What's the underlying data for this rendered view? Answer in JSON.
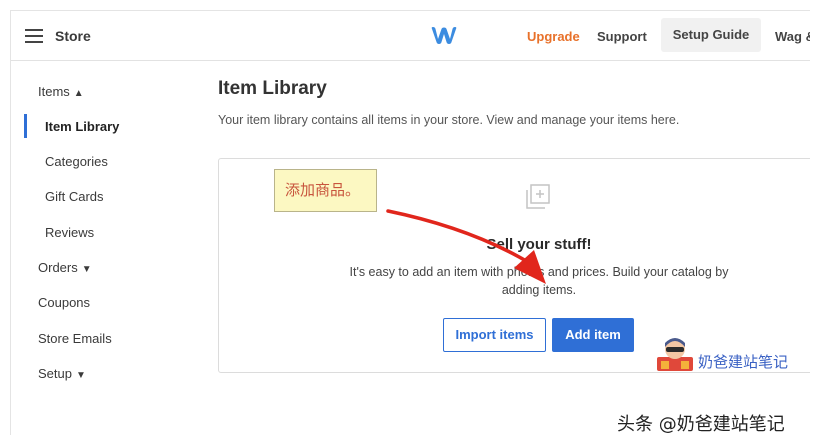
{
  "header": {
    "store_title": "Store",
    "logo_icon": "weebly-w-logo",
    "upgrade": "Upgrade",
    "support": "Support",
    "setup_guide": "Setup Guide",
    "user": "Wag &",
    "accent_color": "#e8712a"
  },
  "sidebar": {
    "items": [
      {
        "label": "Items",
        "caret": "^"
      },
      {
        "label": "Item Library",
        "active": true
      },
      {
        "label": "Categories"
      },
      {
        "label": "Gift Cards"
      },
      {
        "label": "Reviews"
      },
      {
        "label": "Orders",
        "caret": "v"
      },
      {
        "label": "Coupons"
      },
      {
        "label": "Store Emails"
      },
      {
        "label": "Setup",
        "caret": "v"
      }
    ]
  },
  "main": {
    "title": "Item Library",
    "description": "Your item library contains all items in your store. View and manage your items here.",
    "empty_state": {
      "icon": "add-square-icon",
      "heading": "Sell your stuff!",
      "text_line1": "It's easy to add an item with photos and prices. Build your catalog by",
      "text_line2": "adding items.",
      "import_button": "Import items",
      "add_button": "Add item",
      "button_color": "#2f6fd6"
    }
  },
  "overlay": {
    "note": "添加商品。",
    "badge_text": "奶爸建站笔记",
    "watermark": "头条 @奶爸建站笔记",
    "arrow_color": "#e1261c"
  }
}
